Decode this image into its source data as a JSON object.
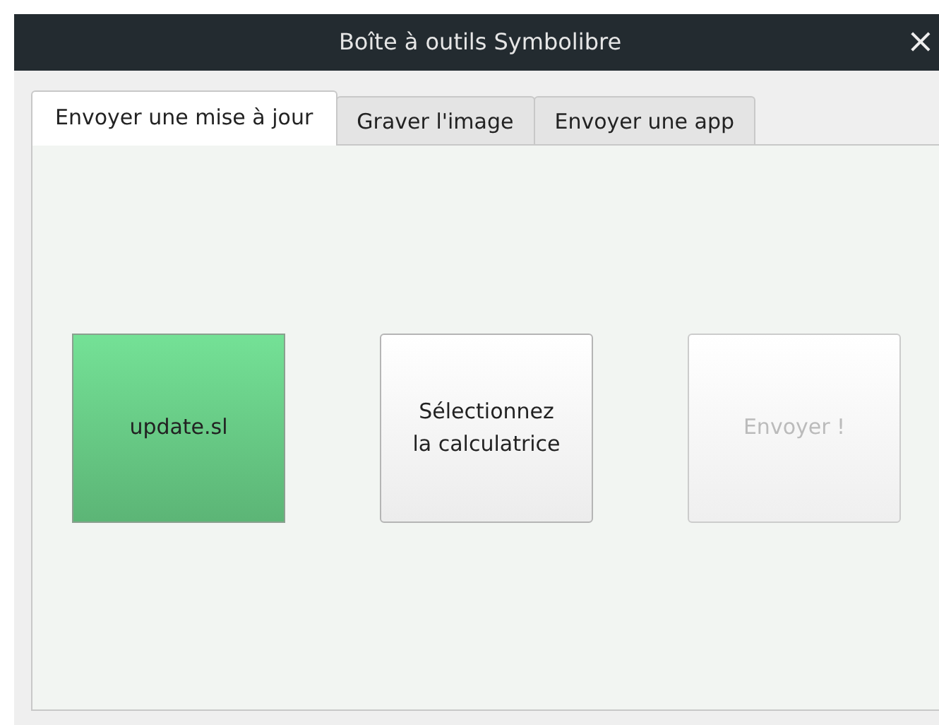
{
  "window": {
    "title": "Boîte à outils Symbolibre",
    "close": "×"
  },
  "tabs": [
    {
      "label": "Envoyer une mise à jour",
      "selected": true
    },
    {
      "label": "Graver l'image",
      "selected": false
    },
    {
      "label": "Envoyer une app",
      "selected": false
    }
  ],
  "buttons": [
    {
      "label": "update.sl",
      "kind": "success",
      "disabled": false
    },
    {
      "label": "Sélectionnez\nla calculatrice",
      "kind": "plain",
      "disabled": false
    },
    {
      "label": "Envoyer !",
      "kind": "plain",
      "disabled": true
    }
  ]
}
